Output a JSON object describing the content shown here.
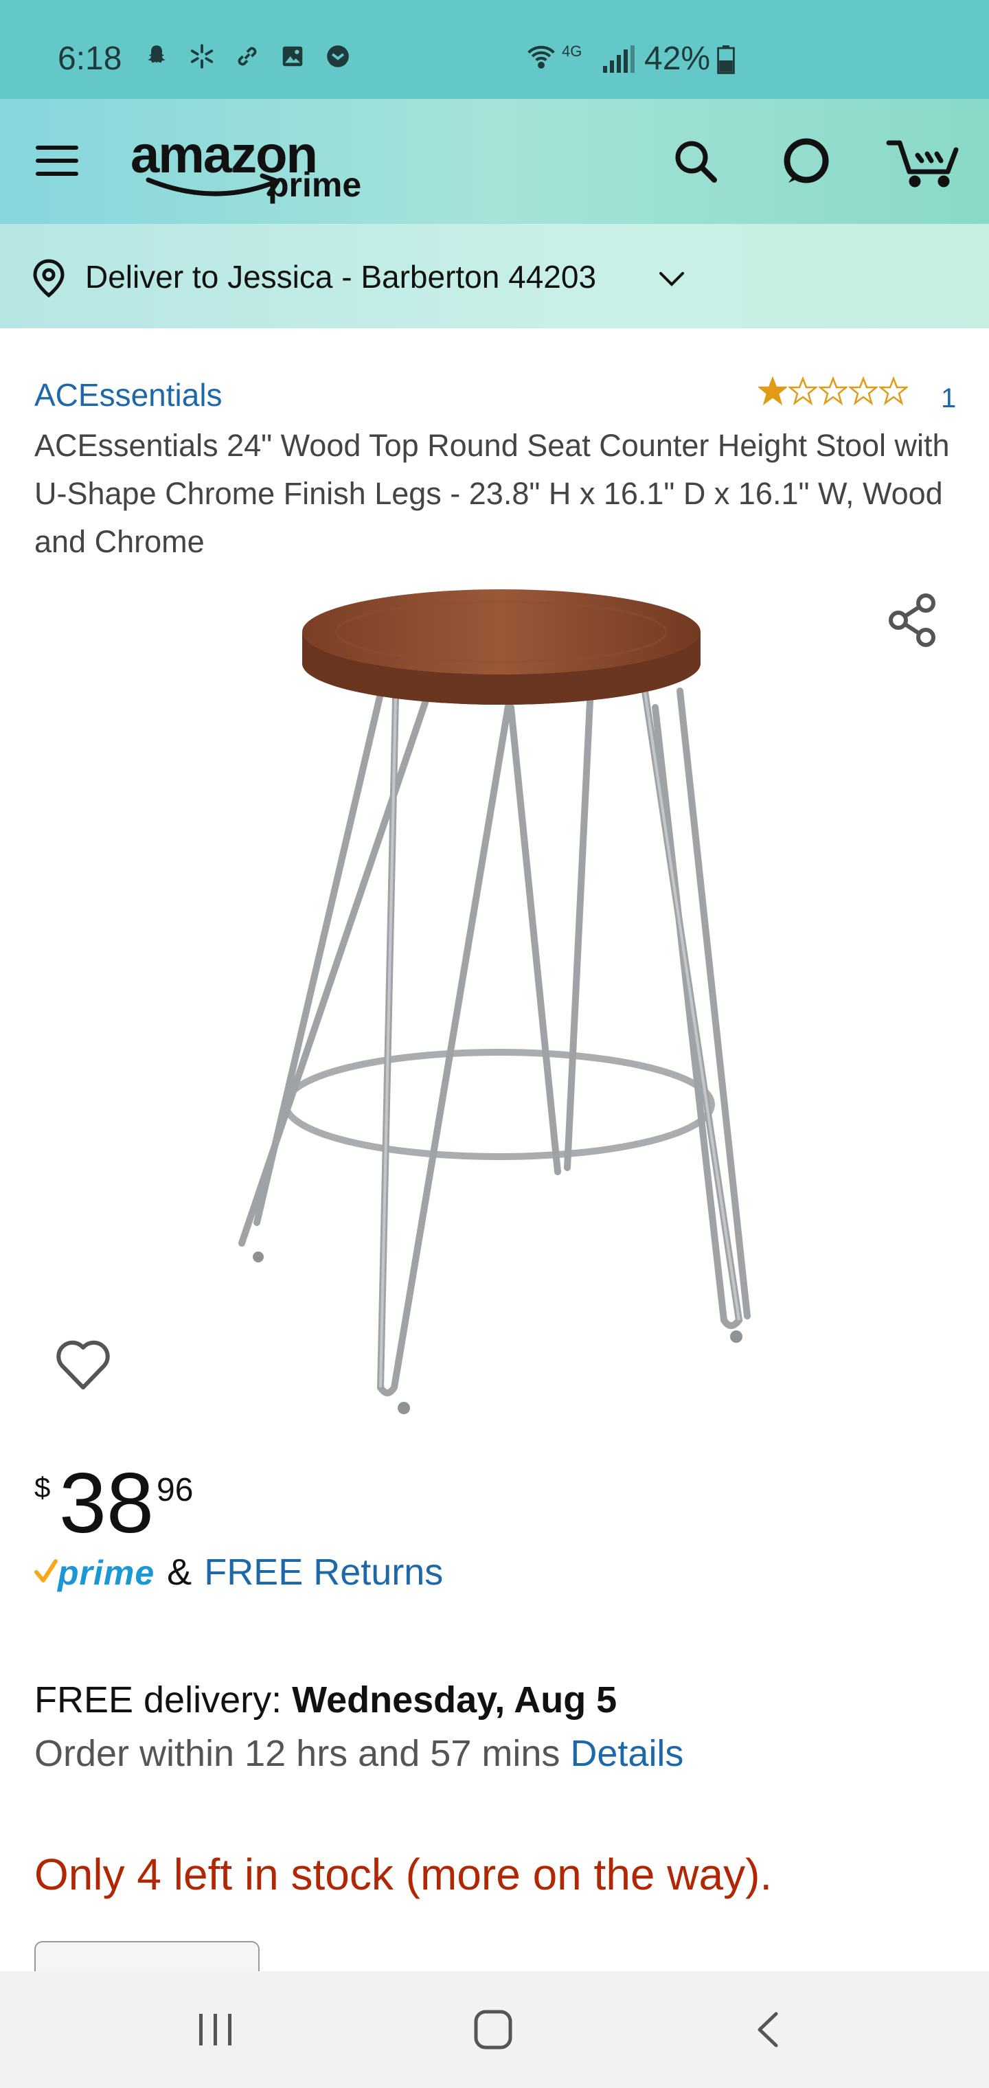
{
  "status_bar": {
    "time": "6:18",
    "network": "4G",
    "battery": "42%",
    "left_icons": [
      "snapchat-icon",
      "walmart-icon",
      "link-icon",
      "gallery-icon",
      "vpn-icon"
    ]
  },
  "header": {
    "logo_main": "amazon",
    "logo_sub": "prime",
    "icons": [
      "menu-icon",
      "search-icon",
      "alexa-icon",
      "cart-icon"
    ]
  },
  "deliver": {
    "label": "Deliver to Jessica - Barberton 44203"
  },
  "product": {
    "brand": "ACEssentials",
    "rating_stars": 1,
    "rating_max": 5,
    "rating_count": "1",
    "title": "ACEssentials 24\" Wood Top Round Seat Counter Height Stool with U-Shape Chrome Finish Legs - 23.8\" H x 16.1\" D x 16.1\" W, Wood and Chrome"
  },
  "price": {
    "symbol": "$",
    "whole": "38",
    "fraction": "96"
  },
  "prime": {
    "badge": "prime",
    "amp": "&",
    "returns": "FREE Returns"
  },
  "delivery": {
    "prefix": "FREE delivery: ",
    "date": "Wednesday, Aug 5",
    "order_within": "Order within 12 hrs and 57 mins ",
    "details": "Details"
  },
  "stock": {
    "message": "Only 4 left in stock (more on the way)."
  },
  "colors": {
    "status_bar": "#63c8c7",
    "link": "#1d68a8",
    "stock": "#b12704",
    "star": "#e09c16",
    "prime_blue": "#1a98d5",
    "prime_check": "#f7a81b"
  },
  "nav_bar": {
    "icons": [
      "recent-apps-icon",
      "home-icon",
      "back-icon"
    ]
  }
}
